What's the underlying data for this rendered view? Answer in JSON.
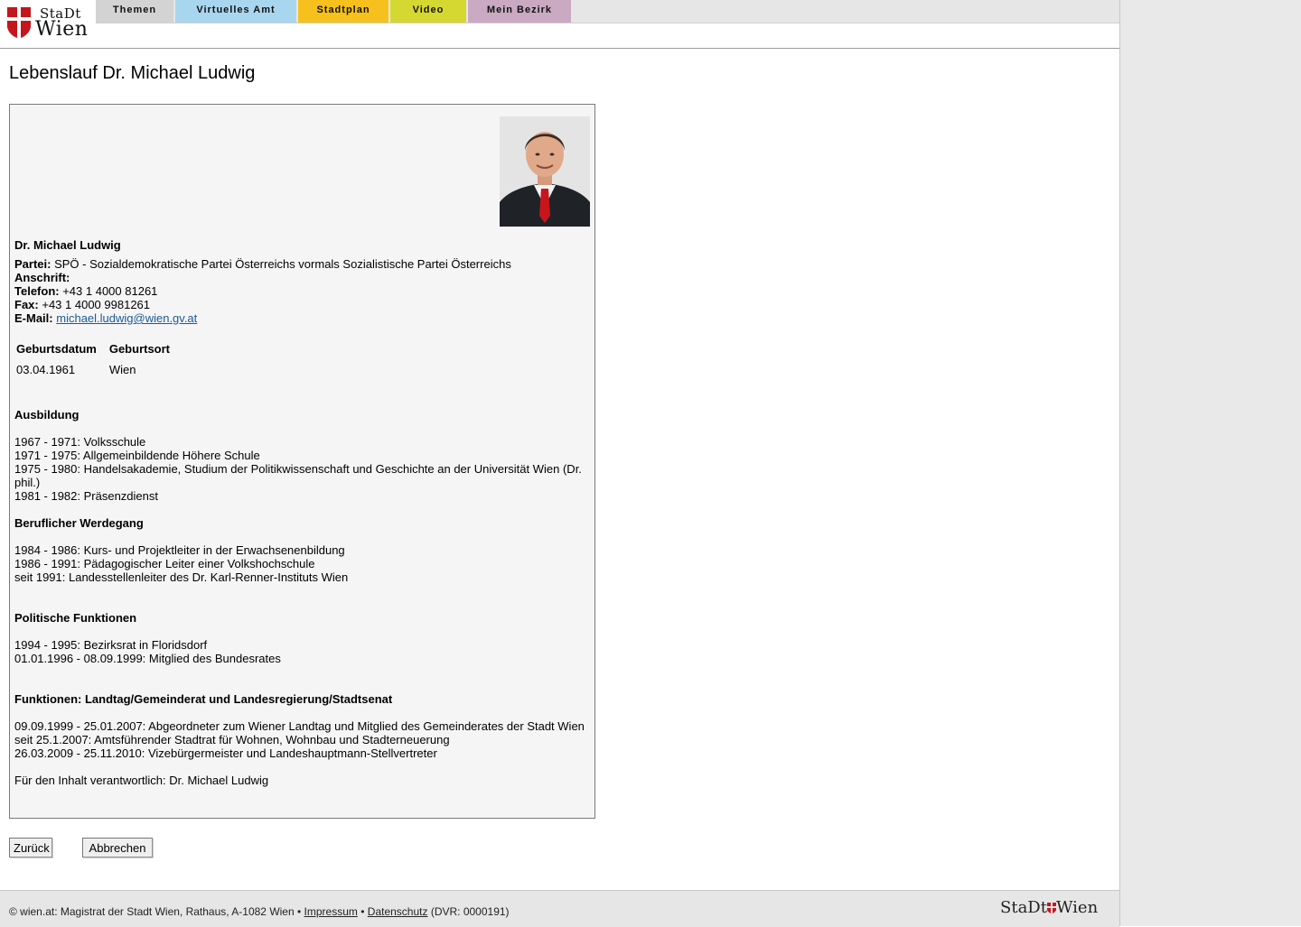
{
  "header": {
    "logo_top": "StaDt",
    "logo_bottom": "Wien",
    "tabs": [
      {
        "label": "Themen",
        "color": "#d3d3d3"
      },
      {
        "label": "Virtuelles Amt",
        "color": "#a9d6ef"
      },
      {
        "label": "Stadtplan",
        "color": "#f6c11c"
      },
      {
        "label": "Video",
        "color": "#d6d832"
      },
      {
        "label": "Mein Bezirk",
        "color": "#c9aac2"
      }
    ]
  },
  "page_title": "Lebenslauf Dr. Michael Ludwig",
  "profile": {
    "name": "Dr. Michael Ludwig",
    "party_label": "Partei:",
    "party_value": "SPÖ - Sozialdemokratische Partei Österreichs vormals Sozialistische Partei Österreichs",
    "address_label": "Anschrift:",
    "phone_label": "Telefon:",
    "phone_value": "+43 1 4000 81261",
    "fax_label": "Fax:",
    "fax_value": "+43 1 4000 9981261",
    "email_label": "E-Mail:",
    "email_value": "michael.ludwig@wien.gv.at",
    "birth_table": {
      "headers": [
        "Geburtsdatum",
        "Geburtsort"
      ],
      "row": [
        "03.04.1961",
        "Wien"
      ]
    },
    "education_title": "Ausbildung",
    "education": [
      "1967 - 1971: Volksschule",
      "1971 - 1975: Allgemeinbildende Höhere Schule",
      "1975 - 1980: Handelsakademie, Studium der Politikwissenschaft und Geschichte an der Universität Wien (Dr. phil.)",
      "1981 - 1982: Präsenzdienst"
    ],
    "career_title": "Beruflicher Werdegang",
    "career": [
      "1984 - 1986: Kurs- und Projektleiter in der Erwachsenenbildung",
      "1986 - 1991: Pädagogischer Leiter einer Volkshochschule",
      "seit 1991: Landesstellenleiter des Dr. Karl-Renner-Instituts Wien"
    ],
    "political_title": "Politische Funktionen",
    "political": [
      "1994 - 1995: Bezirksrat in Floridsdorf",
      "01.01.1996 - 08.09.1999: Mitglied des Bundesrates"
    ],
    "functions_title": "Funktionen: Landtag/Gemeinderat und Landesregierung/Stadtsenat",
    "functions": [
      "09.09.1999 - 25.01.2007: Abgeordneter zum Wiener Landtag und Mitglied des Gemeinderates der Stadt Wien",
      "seit 25.1.2007: Amtsführender Stadtrat für Wohnen, Wohnbau und Stadterneuerung",
      "26.03.2009 - 25.11.2010: Vizebürgermeister und Landeshauptmann-Stellvertreter"
    ],
    "responsible": "Für den Inhalt verantwortlich: Dr. Michael Ludwig"
  },
  "buttons": {
    "back": "Zurück",
    "cancel": "Abbrechen"
  },
  "footer": {
    "text_prefix": "© wien.at: Magistrat der Stadt Wien, Rathaus, A-1082 Wien •",
    "impressum": "Impressum",
    "separator": "•",
    "datenschutz": "Datenschutz",
    "dvr": "(DVR: 0000191)",
    "logo_left": "StaDt",
    "logo_right": "Wien"
  },
  "colors": {
    "brand_red": "#c4161c",
    "link": "#1a5a99"
  }
}
